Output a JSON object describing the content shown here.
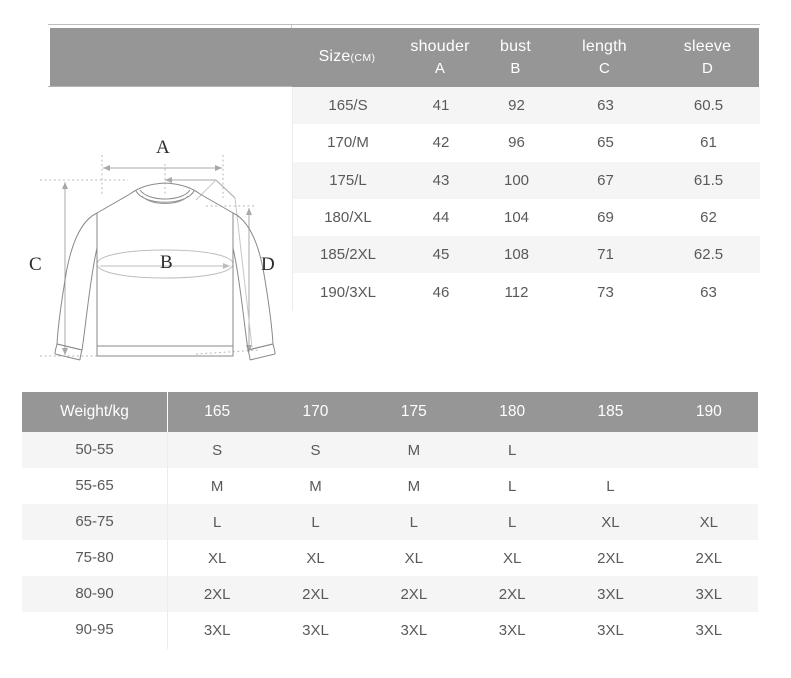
{
  "size_table": {
    "headers": [
      {
        "label": "Size",
        "unit": "(CM)",
        "sub": ""
      },
      {
        "label": "shouder",
        "unit": "",
        "sub": "A"
      },
      {
        "label": "bust",
        "unit": "",
        "sub": "B"
      },
      {
        "label": "length",
        "unit": "",
        "sub": "C"
      },
      {
        "label": "sleeve",
        "unit": "",
        "sub": "D"
      }
    ],
    "rows": [
      {
        "size": "165/S",
        "shoulder": "41",
        "bust": "92",
        "length": "63",
        "sleeve": "60.5"
      },
      {
        "size": "170/M",
        "shoulder": "42",
        "bust": "96",
        "length": "65",
        "sleeve": "61"
      },
      {
        "size": "175/L",
        "shoulder": "43",
        "bust": "100",
        "length": "67",
        "sleeve": "61.5"
      },
      {
        "size": "180/XL",
        "shoulder": "44",
        "bust": "104",
        "length": "69",
        "sleeve": "62"
      },
      {
        "size": "185/2XL",
        "shoulder": "45",
        "bust": "108",
        "length": "71",
        "sleeve": "62.5"
      },
      {
        "size": "190/3XL",
        "shoulder": "46",
        "bust": "112",
        "length": "73",
        "sleeve": "63"
      }
    ]
  },
  "diagram": {
    "labels": {
      "a": "A",
      "b": "B",
      "c": "C",
      "d": "D"
    }
  },
  "weight_table": {
    "header": {
      "label": "Weight/kg",
      "heights": [
        "165",
        "170",
        "175",
        "180",
        "185",
        "190"
      ]
    },
    "rows": [
      {
        "weight": "50-55",
        "sizes": [
          "S",
          "S",
          "M",
          "L",
          "",
          ""
        ]
      },
      {
        "weight": "55-65",
        "sizes": [
          "M",
          "M",
          "M",
          "L",
          "L",
          ""
        ]
      },
      {
        "weight": "65-75",
        "sizes": [
          "L",
          "L",
          "L",
          "L",
          "XL",
          "XL"
        ]
      },
      {
        "weight": "75-80",
        "sizes": [
          "XL",
          "XL",
          "XL",
          "XL",
          "2XL",
          "2XL"
        ]
      },
      {
        "weight": "80-90",
        "sizes": [
          "2XL",
          "2XL",
          "2XL",
          "2XL",
          "3XL",
          "3XL"
        ]
      },
      {
        "weight": "90-95",
        "sizes": [
          "3XL",
          "3XL",
          "3XL",
          "3XL",
          "3XL",
          "3XL"
        ]
      }
    ]
  },
  "colors": {
    "header_grey": "#969696",
    "row_alt": "#f5f5f5",
    "text": "#595959",
    "line": "#8a8a8a"
  }
}
